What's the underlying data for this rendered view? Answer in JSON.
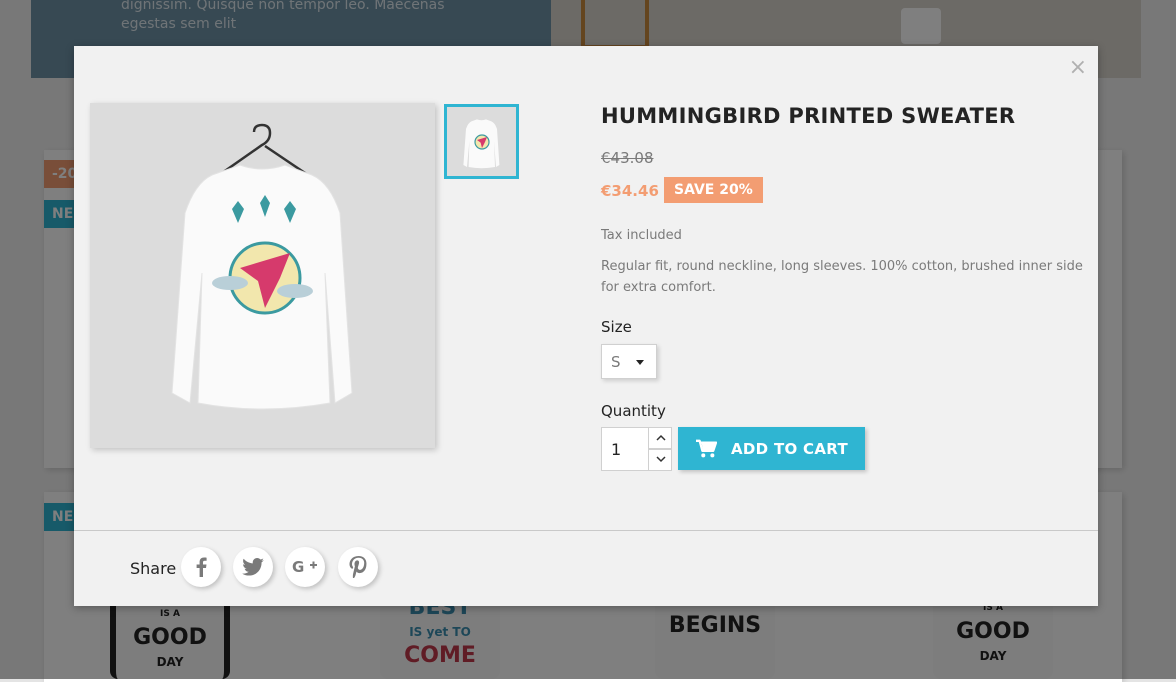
{
  "background": {
    "hero_text": "dignissim. Quisque non tempor leo. Maecenas egestas sem elit",
    "badges": {
      "discount": "-20",
      "new_1": "NE",
      "new_2": "NE"
    },
    "mugs": [
      {
        "lines": [
          "IS A",
          "GOOD",
          "DAY"
        ]
      },
      {
        "lines": [
          "BEST",
          "IS yet TO",
          "COME"
        ]
      },
      {
        "lines": [
          "BEGINS"
        ]
      },
      {
        "lines": [
          "IS A",
          "GOOD",
          "DAY"
        ]
      }
    ]
  },
  "modal": {
    "close_label": "×",
    "product": {
      "title": "HUMMINGBIRD PRINTED SWEATER",
      "old_price": "€43.08",
      "price": "€34.46",
      "discount_label": "SAVE 20%",
      "tax_note": "Tax included",
      "description": "Regular fit, round neckline, long sleeves. 100% cotton, brushed inner side for extra comfort."
    },
    "size": {
      "label": "Size",
      "selected": "S"
    },
    "quantity": {
      "label": "Quantity",
      "value": "1"
    },
    "add_to_cart_label": "ADD TO CART",
    "share": {
      "label": "Share",
      "networks": [
        "facebook",
        "twitter",
        "google-plus",
        "pinterest"
      ]
    }
  },
  "colors": {
    "accent": "#2fb5d2",
    "discount": "#f39d72",
    "overlay": "#000000"
  }
}
